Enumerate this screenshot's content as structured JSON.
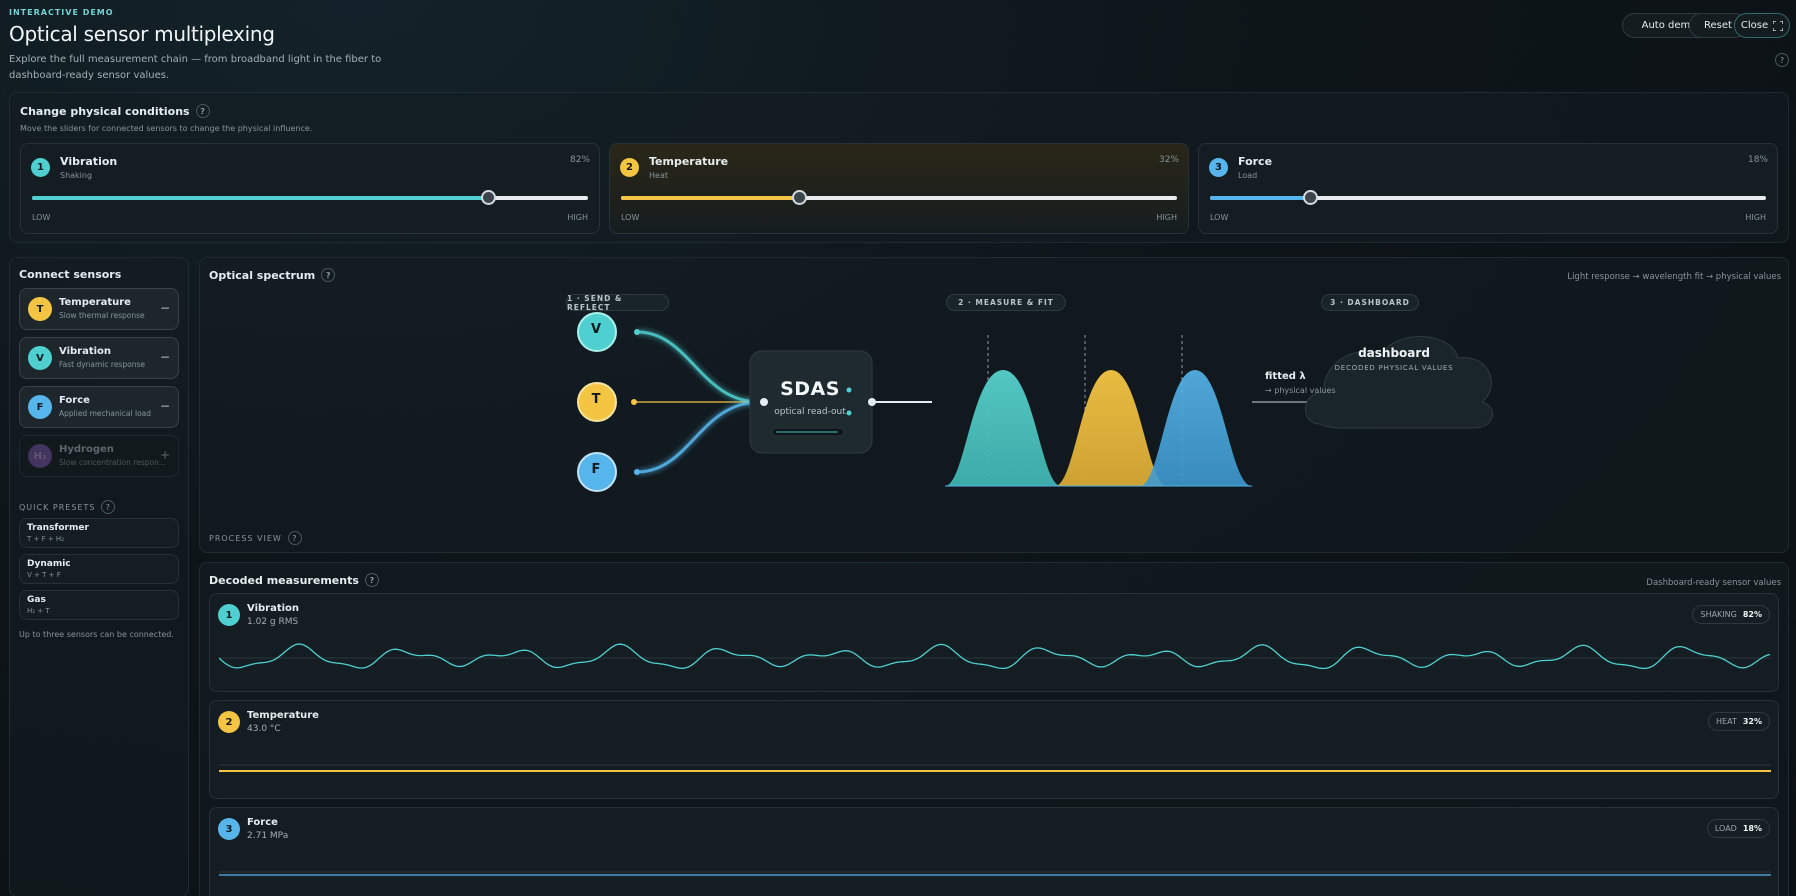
{
  "header": {
    "eyebrow": "INTERACTIVE DEMO",
    "title": "Optical sensor multiplexing",
    "description": "Explore the full measurement chain — from broadband light in the fiber to dashboard-ready sensor values.",
    "buttons": {
      "auto_demo": "Auto demo",
      "reset": "Reset",
      "close": "Close"
    },
    "help": "?"
  },
  "conditions": {
    "title": "Change physical conditions",
    "subtitle": "Move the sliders for connected sensors to change the physical influence.",
    "help": "?",
    "low": "LOW",
    "high": "HIGH",
    "sensors": [
      {
        "num": "1",
        "name": "Vibration",
        "sub": "Shaking",
        "pct_label": "82%",
        "level": 0.82,
        "color": "#4fcfcf"
      },
      {
        "num": "2",
        "name": "Temperature",
        "sub": "Heat",
        "pct_label": "32%",
        "level": 0.32,
        "color": "#f4c542"
      },
      {
        "num": "3",
        "name": "Force",
        "sub": "Load",
        "pct_label": "18%",
        "level": 0.18,
        "color": "#56b6ec"
      }
    ]
  },
  "connect": {
    "title": "Connect sensors",
    "sensors": [
      {
        "letter": "T",
        "name": "Temperature",
        "sub": "Slow thermal response",
        "action": "−",
        "color": "#f4c542"
      },
      {
        "letter": "V",
        "name": "Vibration",
        "sub": "Fast dynamic response",
        "action": "−",
        "color": "#4fcfcf"
      },
      {
        "letter": "F",
        "name": "Force",
        "sub": "Applied mechanical load",
        "action": "−",
        "color": "#56b6ec"
      },
      {
        "letter": "H₂",
        "name": "Hydrogen",
        "sub": "Slow concentration respon...",
        "action": "+",
        "color": "#8a5cc4"
      }
    ],
    "presets_title": "QUICK PRESETS",
    "presets": [
      {
        "name": "Transformer",
        "sub": "T + F + H₂"
      },
      {
        "name": "Dynamic",
        "sub": "V + T + F"
      },
      {
        "name": "Gas",
        "sub": "H₂ + T"
      }
    ],
    "note": "Up to three sensors can be connected."
  },
  "spectrum": {
    "title": "Optical spectrum",
    "right_note": "Light response → wavelength fit → physical values",
    "phases": [
      "1 · SEND & REFLECT",
      "2 · MEASURE & FIT",
      "3 · DASHBOARD"
    ],
    "nodes": [
      "V",
      "T",
      "F"
    ],
    "sdas_title": "SDAS",
    "sdas_sub": "optical read-out",
    "fit_label": "fitted λ",
    "fit_sub": "→ physical values",
    "cloud_title": "dashboard",
    "cloud_sub": "DECODED PHYSICAL VALUES",
    "process_view": "PROCESS VIEW"
  },
  "decoded": {
    "title": "Decoded measurements",
    "right_note": "Dashboard-ready sensor values",
    "rows": [
      {
        "num": "1",
        "name": "Vibration",
        "value": "1.02 g RMS",
        "badge_label": "SHAKING",
        "badge_pct": "82%",
        "color": "#4fcfcf"
      },
      {
        "num": "2",
        "name": "Temperature",
        "value": "43.0 °C",
        "badge_label": "HEAT",
        "badge_pct": "32%",
        "color": "#f4c542"
      },
      {
        "num": "3",
        "name": "Force",
        "value": "2.71 MPa",
        "badge_label": "LOAD",
        "badge_pct": "18%",
        "color": "#56b6ec"
      }
    ]
  }
}
